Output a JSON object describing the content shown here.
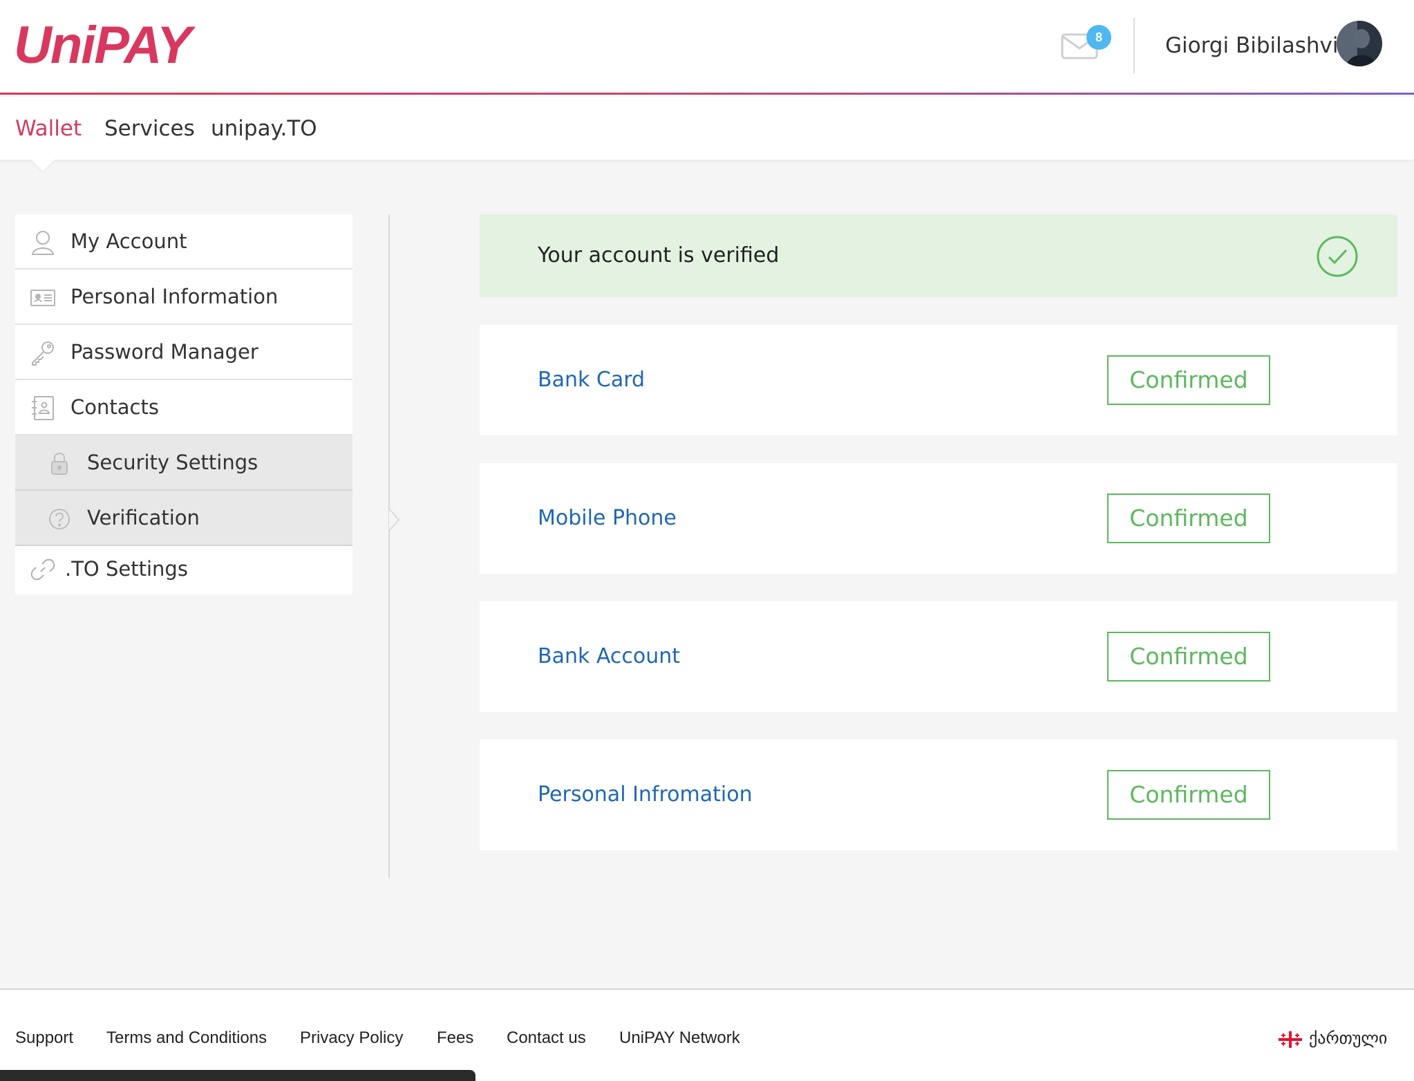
{
  "header": {
    "logo": "UniPAY",
    "mail_count": "8",
    "user_name": "Giorgi Bibilashvili"
  },
  "nav": {
    "items": [
      {
        "label": "Wallet",
        "active": true
      },
      {
        "label": "Services",
        "active": false
      },
      {
        "label": "unipay.TO",
        "active": false
      }
    ]
  },
  "sidebar": {
    "items": [
      {
        "label": "My Account",
        "icon": "user-icon"
      },
      {
        "label": "Personal Information",
        "icon": "id-card-icon"
      },
      {
        "label": "Password Manager",
        "icon": "key-icon"
      },
      {
        "label": "Contacts",
        "icon": "address-book-icon"
      },
      {
        "label": "Security Settings",
        "icon": "lock-icon"
      },
      {
        "label": "Verification",
        "icon": "question-circle-icon"
      },
      {
        "label": ".TO Settings",
        "icon": "link-icon"
      }
    ]
  },
  "verification": {
    "banner_text": "Your account is verified",
    "items": [
      {
        "label": "Bank Card",
        "status": "Confirmed"
      },
      {
        "label": "Mobile Phone",
        "status": "Confirmed"
      },
      {
        "label": "Bank Account",
        "status": "Confirmed"
      },
      {
        "label": "Personal Infromation",
        "status": "Confirmed"
      }
    ]
  },
  "footer": {
    "links": [
      "Support",
      "Terms and Conditions",
      "Privacy Policy",
      "Fees",
      "Contact us",
      "UniPAY Network"
    ],
    "language": "ქართული"
  },
  "colors": {
    "brand": "#d9385e",
    "link_blue": "#1f67b5",
    "confirm_green": "#5cb85c",
    "verified_bg": "#e3f2e1"
  }
}
